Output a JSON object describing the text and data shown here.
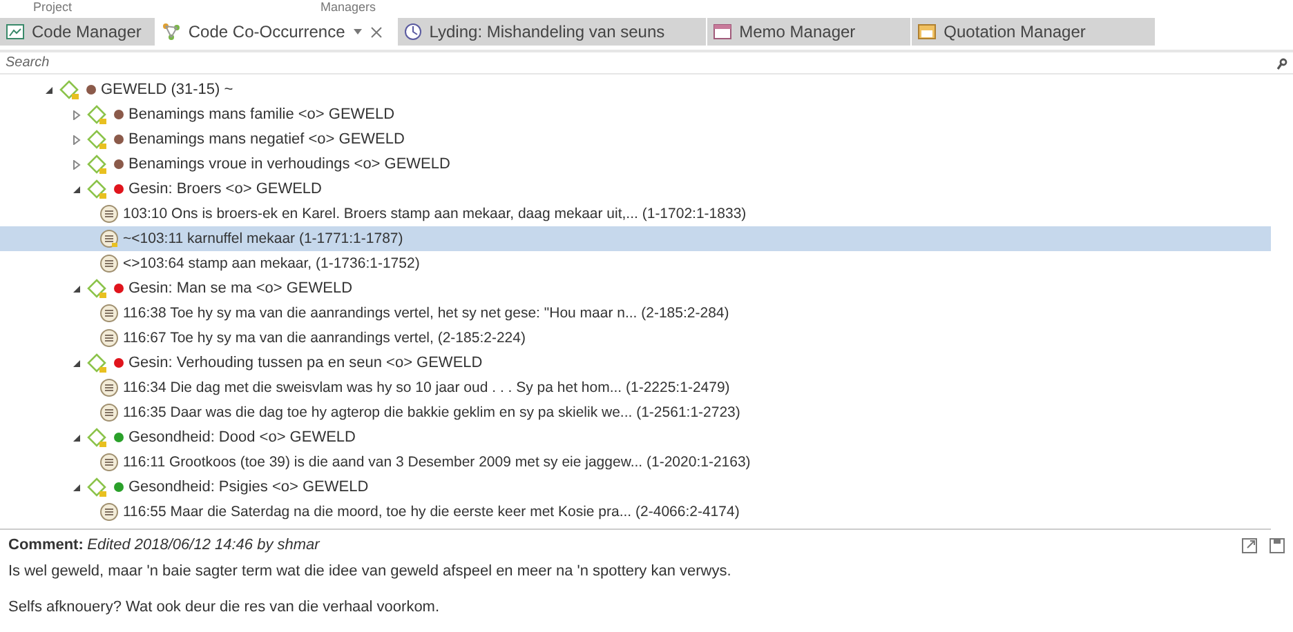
{
  "ribbon_groups": [
    "Project",
    "Managers"
  ],
  "tabs": [
    {
      "label": "Code Manager",
      "kind": "code",
      "selected": false
    },
    {
      "label": "Code Co-Occurrence",
      "kind": "cooccurrence",
      "selected": true
    },
    {
      "label": "Lyding: Mishandeling van seuns",
      "kind": "document",
      "selected": false
    },
    {
      "label": "Memo Manager",
      "kind": "memo",
      "selected": false
    },
    {
      "label": "Quotation Manager",
      "kind": "quotation",
      "selected": false
    }
  ],
  "search": {
    "placeholder": "Search"
  },
  "tree": [
    {
      "kind": "code",
      "label": "GEWELD (31-15) ~",
      "color": "#8b5a4a",
      "expanded": true,
      "selected": false,
      "children": [
        {
          "kind": "code",
          "label": "Benamings mans familie <o> GEWELD",
          "color": "#8b5a4a",
          "expanded": false,
          "selected": false
        },
        {
          "kind": "code",
          "label": "Benamings mans negatief <o> GEWELD",
          "color": "#8b5a4a",
          "expanded": false,
          "selected": false
        },
        {
          "kind": "code",
          "label": "Benamings vroue in verhoudings <o> GEWELD",
          "color": "#8b5a4a",
          "expanded": false,
          "selected": false
        },
        {
          "kind": "code",
          "label": "Gesin: Broers <o> GEWELD",
          "color": "#e0141c",
          "expanded": true,
          "selected": false,
          "children": [
            {
              "kind": "quotation",
              "label": "103:10 Ons is broers-ek en Karel. Broers stamp aan mekaar, daag  mekaar uit,... (1-1702:1-1833)",
              "commented": false,
              "selected": false
            },
            {
              "kind": "quotation",
              "label": "~<103:11 karnuffel mekaar (1-1771:1-1787)",
              "commented": true,
              "selected": true
            },
            {
              "kind": "quotation",
              "label": "<>103:64 stamp aan mekaar, (1-1736:1-1752)",
              "commented": false,
              "selected": false
            }
          ]
        },
        {
          "kind": "code",
          "label": "Gesin: Man se ma <o> GEWELD",
          "color": "#e0141c",
          "expanded": true,
          "selected": false,
          "children": [
            {
              "kind": "quotation",
              "label": "116:38 Toe hy sy ma van die aanrandings vertel, het sy net gese:  \"Hou maar n... (2-185:2-284)",
              "commented": false,
              "selected": false
            },
            {
              "kind": "quotation",
              "label": "116:67 Toe hy sy ma van die aanrandings vertel, (2-185:2-224)",
              "commented": false,
              "selected": false
            }
          ]
        },
        {
          "kind": "code",
          "label": "Gesin: Verhouding tussen pa en seun <o> GEWELD",
          "color": "#e0141c",
          "expanded": true,
          "selected": false,
          "children": [
            {
              "kind": "quotation",
              "label": "116:34 Die dag met die sweisvlam  was hy so 10 jaar oud . . . Sy pa  het hom... (1-2225:1-2479)",
              "commented": false,
              "selected": false
            },
            {
              "kind": "quotation",
              "label": "116:35 Daar was die dag toe hy agterop die bakkie geklim en sy pa  skielik we... (1-2561:1-2723)",
              "commented": false,
              "selected": false
            }
          ]
        },
        {
          "kind": "code",
          "label": "Gesondheid: Dood <o> GEWELD",
          "color": "#2aa02a",
          "expanded": true,
          "selected": false,
          "children": [
            {
              "kind": "quotation",
              "label": "116:11 Grootkoos (toe 39) is die  aand van 3 Desember 2009 met  sy eie jaggew... (1-2020:1-2163)",
              "commented": false,
              "selected": false
            }
          ]
        },
        {
          "kind": "code",
          "label": "Gesondheid: Psigies <o> GEWELD",
          "color": "#2aa02a",
          "expanded": true,
          "selected": false,
          "children": [
            {
              "kind": "quotation",
              "label": "116:55 Maar die Saterdag na die  moord, toe hy die eerste keer  met Kosie pra... (2-4066:2-4174)",
              "commented": false,
              "selected": false
            }
          ]
        }
      ]
    }
  ],
  "comment": {
    "label": "Comment:",
    "meta": "Edited 2018/06/12 14:46 by shmar",
    "paragraphs": [
      "Is wel geweld, maar 'n baie sagter term wat die idee van geweld afspeel en meer na 'n spottery kan verwys.",
      "Selfs afknouery? Wat ook deur die res van die verhaal voorkom."
    ]
  }
}
